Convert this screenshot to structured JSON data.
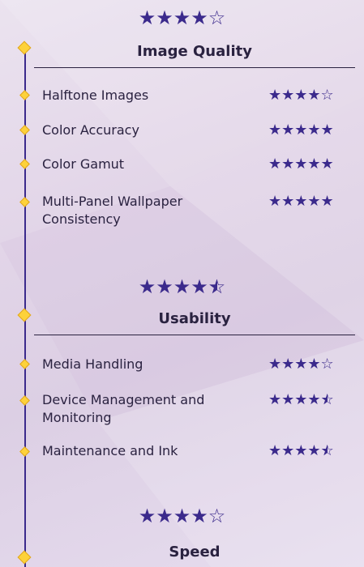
{
  "sections": [
    {
      "title": "Image Quality",
      "rating": "★★★★☆",
      "items": [
        {
          "label": "Halftone Images",
          "rating": "★★★★☆"
        },
        {
          "label": "Color Accuracy",
          "rating": "★★★★★"
        },
        {
          "label": "Color Gamut",
          "rating": "★★★★★"
        },
        {
          "label": "Multi-Panel Wallpaper Consistency",
          "rating": "★★★★★"
        }
      ]
    },
    {
      "title": "Usability",
      "rating": "★★★★½",
      "items": [
        {
          "label": "Media Handling",
          "rating": "★★★★☆"
        },
        {
          "label": "Device Management and Monitoring",
          "rating": "★★★★½"
        },
        {
          "label": "Maintenance and Ink",
          "rating": "★★★★½"
        }
      ]
    },
    {
      "title": "Speed",
      "rating": "★★★★☆",
      "items": []
    }
  ],
  "colors": {
    "accent": "#3b2a8c",
    "diamond": "#fdd23a",
    "text": "#2a2240"
  }
}
